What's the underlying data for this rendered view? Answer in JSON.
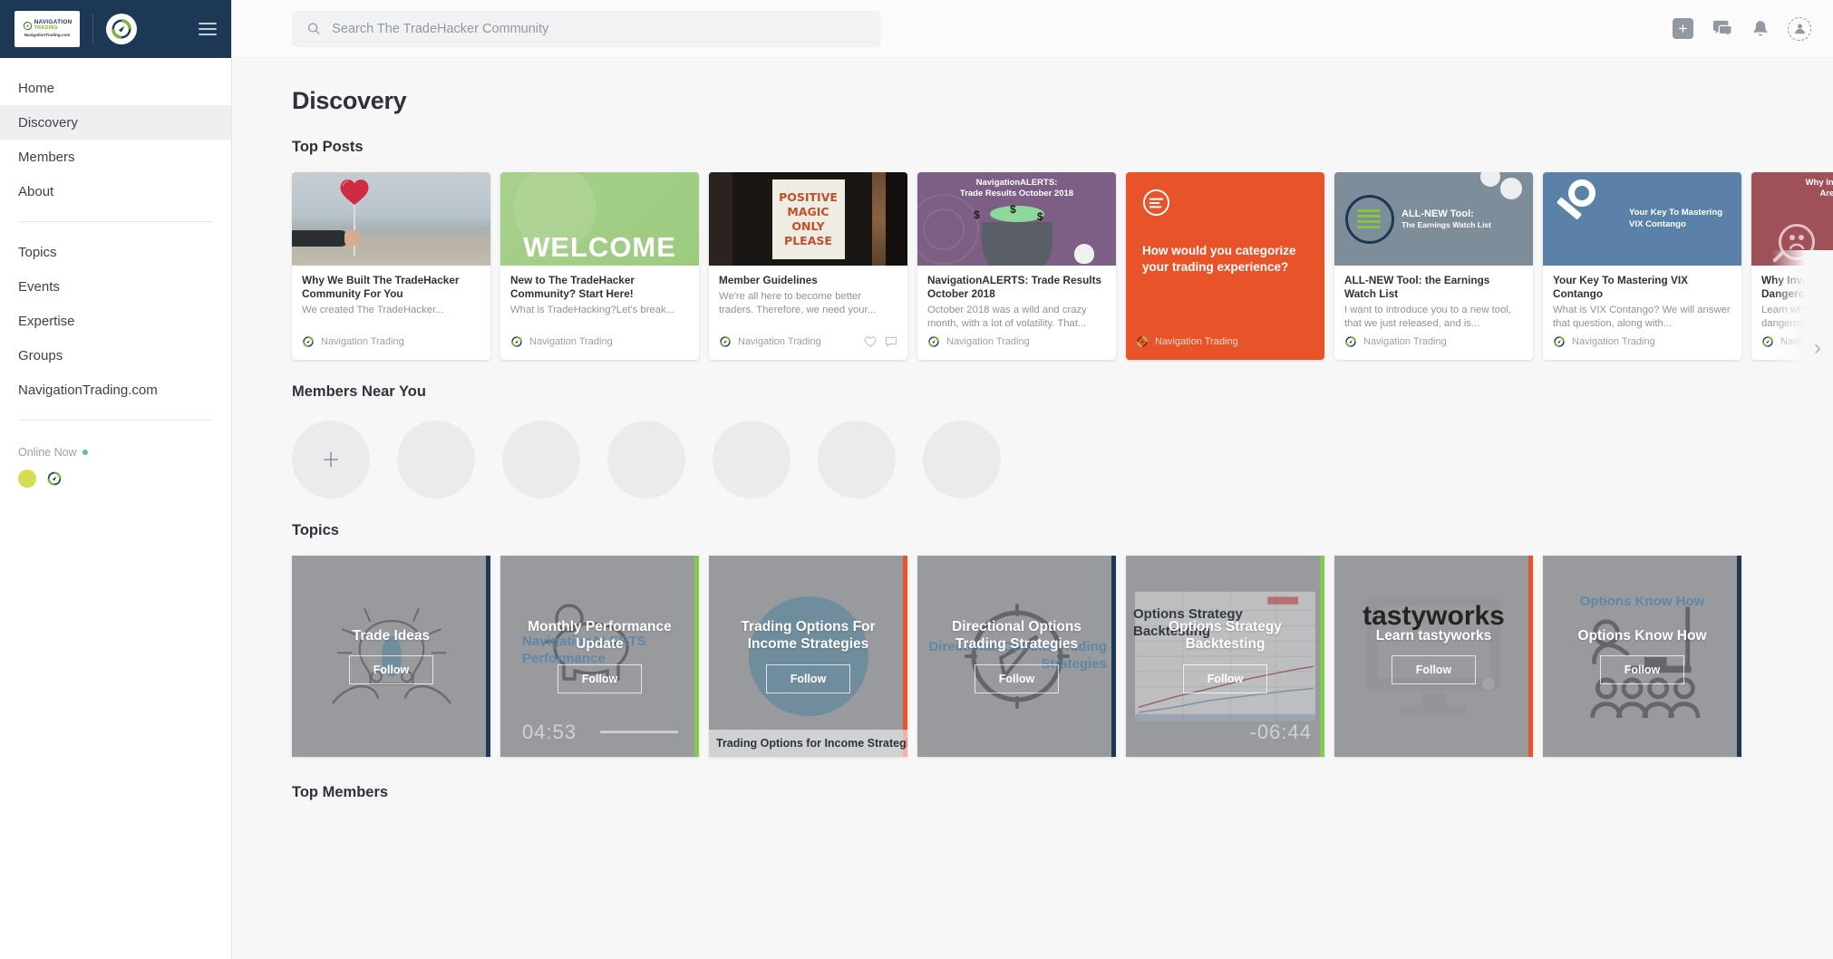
{
  "brand": {
    "logo_line1": "NAVIGATION",
    "logo_line2": "TRADING",
    "logo_url": "NavigationTrading.com",
    "menu_icon": "hamburger-icon"
  },
  "sidebar": {
    "primary_items": [
      {
        "label": "Home",
        "active": false
      },
      {
        "label": "Discovery",
        "active": true
      },
      {
        "label": "Members",
        "active": false
      },
      {
        "label": "About",
        "active": false
      }
    ],
    "secondary_items": [
      {
        "label": "Topics"
      },
      {
        "label": "Events"
      },
      {
        "label": "Expertise"
      },
      {
        "label": "Groups"
      },
      {
        "label": "NavigationTrading.com"
      }
    ],
    "online": {
      "label": "Online Now",
      "dot_color": "#5fc27e",
      "avatars": [
        "yellow-avatar",
        "navigation-trading-avatar"
      ]
    }
  },
  "topbar": {
    "search_placeholder": "Search The TradeHacker Community",
    "search_value": "",
    "icons": [
      "add-icon",
      "messages-icon",
      "notifications-icon",
      "account-avatar-icon"
    ]
  },
  "page": {
    "title": "Discovery",
    "sections": {
      "top_posts": "Top Posts",
      "members_near_you": "Members Near You",
      "topics": "Topics",
      "top_members": "Top Members"
    }
  },
  "top_posts": [
    {
      "title": "Why We Built The TradeHacker Community For You",
      "excerpt": "We created The TradeHacker...",
      "author": "Navigation Trading",
      "thumb": "beach-heart-balloon",
      "type": "article"
    },
    {
      "title": "New to The TradeHacker Community? Start Here!",
      "excerpt": "What is TradeHacking?Let's break...",
      "author": "Navigation Trading",
      "thumb": "welcome-green",
      "thumb_text": "WELCOME",
      "type": "article"
    },
    {
      "title": "Member Guidelines",
      "excerpt": "We're all here to become better traders. Therefore, we need your...",
      "author": "Navigation Trading",
      "thumb": "positive-magic-sign",
      "thumb_lines": [
        "POSITIVE",
        "MAGIC",
        "ONLY",
        "PLEASE"
      ],
      "type": "article",
      "has_reactions": true
    },
    {
      "title": "NavigationALERTS: Trade Results October 2018",
      "excerpt": "October 2018 was a wild and crazy month, with a lot of volatility. That...",
      "author": "Navigation Trading",
      "thumb": "halloween-cauldron",
      "thumb_text_line1": "NavigationALERTS:",
      "thumb_text_line2": "Trade Results October 2018",
      "type": "article"
    },
    {
      "title": "",
      "excerpt": "",
      "author": "Navigation Trading",
      "thumb": "poll-orange",
      "poll_question": "How would you categorize your trading experience?",
      "type": "poll",
      "color": "#e8532a"
    },
    {
      "title": "ALL-NEW Tool: the Earnings Watch List",
      "excerpt": "I want to introduce you to a new tool, that we just released, and is...",
      "author": "Navigation Trading",
      "thumb": "earnings-watch-list",
      "thumb_text_line1": "ALL-NEW Tool:",
      "thumb_text_line2": "The Earnings Watch List",
      "type": "article"
    },
    {
      "title": "Your Key To Mastering VIX Contango",
      "excerpt": "What is VIX Contango? We will answer that question, along with...",
      "author": "Navigation Trading",
      "thumb": "key-vix-contango",
      "thumb_text_line1": "Your Key To Mastering",
      "thumb_text_line2": "VIX Contango",
      "type": "article"
    },
    {
      "title": "Why Inverse VIX ETFs Are Dangerous",
      "excerpt": "Learn why Inverse VIX ETFs are dangerous. We'll cover...",
      "author": "Navigation Trading",
      "thumb": "inverse-vix-magnifier",
      "thumb_text_line1": "Why Inverse VIX ETFs",
      "thumb_text_line2": "Are Dangerous",
      "type": "article"
    }
  ],
  "members_near_you": {
    "add_label": "+",
    "placeholder_count": 6
  },
  "topics": [
    {
      "name": "Trade Ideas",
      "follow_label": "Follow",
      "accent_color": "#1d3855",
      "art": "lightbulb-hands",
      "ghost_title": "",
      "timecode": "",
      "caption": ""
    },
    {
      "name": "Monthly Performance Update",
      "follow_label": "Follow",
      "accent_color": "#7fcb4f",
      "art": "piggy-bank",
      "ghost_title": "NavigationALERTS Performance",
      "timecode": "04:53",
      "caption": ""
    },
    {
      "name": "Trading Options For Income Strategies",
      "follow_label": "Follow",
      "accent_color": "#e8532a",
      "art": "blue-circle-chart",
      "ghost_title": "",
      "timecode": "",
      "caption": "Trading Options for Income Strategies"
    },
    {
      "name": "Directional Options Trading Strategies",
      "follow_label": "Follow",
      "accent_color": "#1d3855",
      "art": "compass",
      "ghost_title": "Directional Options Trading Strategies",
      "timecode": "",
      "caption": ""
    },
    {
      "name": "Options Strategy Backtesting",
      "follow_label": "Follow",
      "accent_color": "#7fcb4f",
      "art": "spreadsheet",
      "ghost_title": "Options Strategy Backtesting",
      "timecode": "-06:44",
      "caption": ""
    },
    {
      "name": "Learn tastyworks",
      "follow_label": "Follow",
      "accent_color": "#e8532a",
      "art": "monitor-tastyworks",
      "ghost_title": "Learn tastyworks",
      "timecode": "",
      "caption": ""
    },
    {
      "name": "Options Know How",
      "follow_label": "Follow",
      "accent_color": "#1d3855",
      "art": "teacher-audience",
      "ghost_title": "Options Know How",
      "timecode": "",
      "caption": ""
    }
  ],
  "carousel": {
    "next_label": "›"
  },
  "colors": {
    "sidebar_header": "#1d3855",
    "accent_orange": "#e8532a",
    "accent_green": "#7fcb4f",
    "page_bg": "#f7f7f8",
    "active_nav": "#eeeff0"
  }
}
